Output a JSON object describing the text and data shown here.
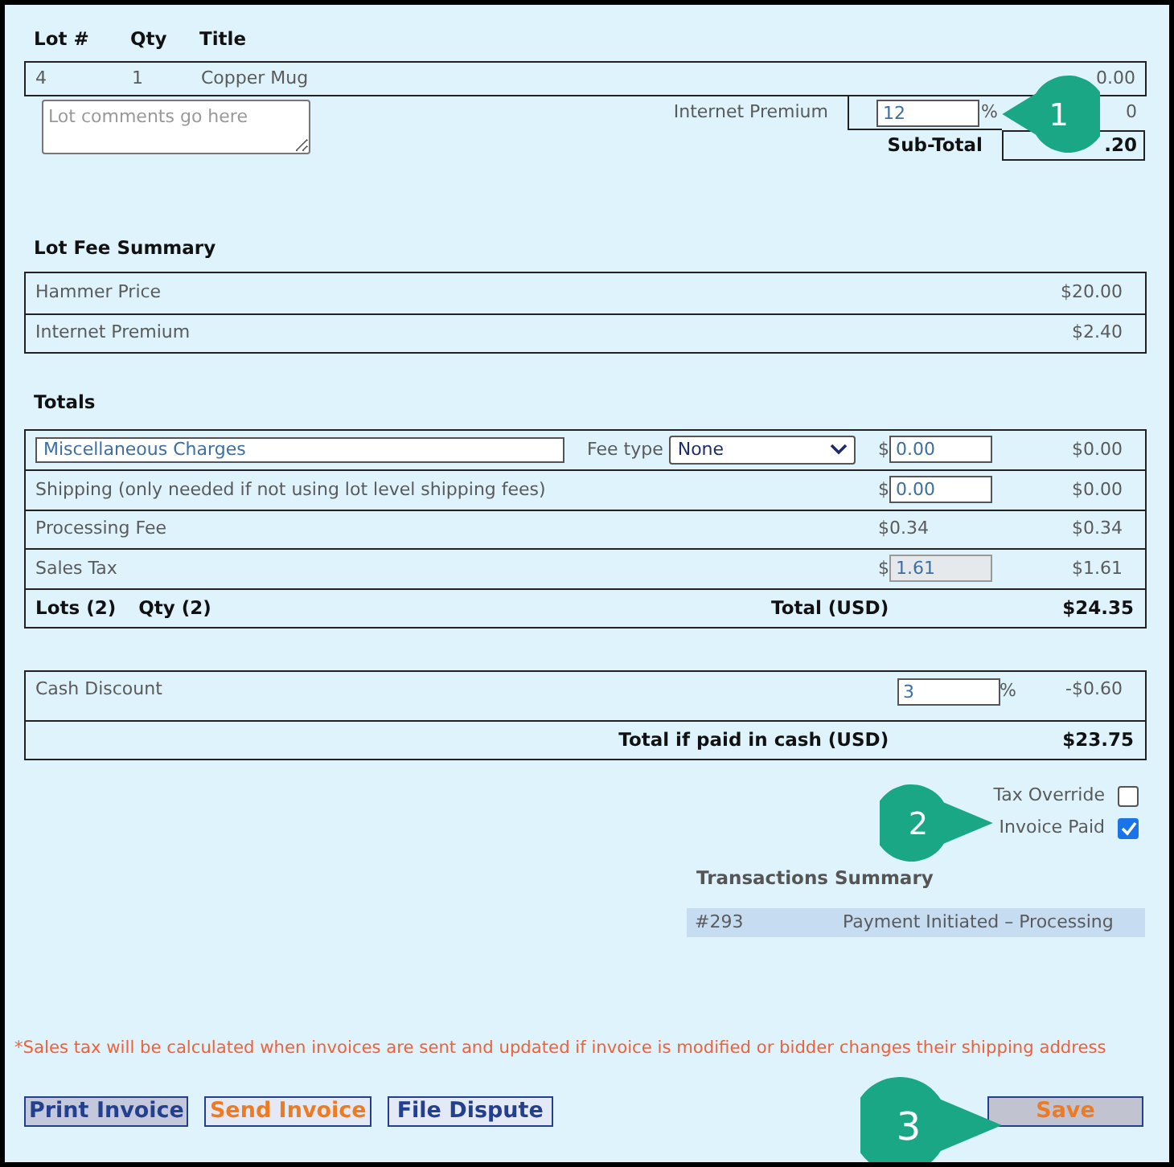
{
  "lot_table": {
    "columns": [
      "Lot #",
      "Qty",
      "Title"
    ],
    "rows": [
      {
        "lot": "4",
        "qty": "1",
        "title": "Copper Mug",
        "amount": "0.00"
      }
    ]
  },
  "lot_comments": {
    "placeholder": "Lot comments go here"
  },
  "internet_premium": {
    "label": "Internet Premium",
    "value": "12",
    "unit": "%",
    "amount": "0"
  },
  "subtotal": {
    "label": "Sub-Total",
    "amount": ".20"
  },
  "lot_fee_summary": {
    "title": "Lot Fee Summary",
    "rows": [
      {
        "label": "Hammer Price",
        "amount": "$20.00"
      },
      {
        "label": "Internet Premium",
        "amount": "$2.40"
      }
    ]
  },
  "totals": {
    "title": "Totals",
    "rows": [
      {
        "kind": "misc",
        "label": "Miscellaneous Charges",
        "fee_type_label": "Fee type",
        "fee_type": "None",
        "currency": "$",
        "value": "0.00",
        "disabled": false,
        "amount": "$0.00"
      },
      {
        "kind": "input",
        "label": "Shipping (only needed if not using lot level shipping fees)",
        "currency": "$",
        "value": "0.00",
        "disabled": false,
        "amount": "$0.00"
      },
      {
        "kind": "fixed",
        "label": "Processing Fee",
        "value": "$0.34",
        "amount": "$0.34"
      },
      {
        "kind": "input",
        "label": "Sales Tax",
        "currency": "$",
        "value": "1.61",
        "disabled": true,
        "amount": "$1.61"
      }
    ],
    "summary": {
      "lots": "Lots (2)",
      "qty": "Qty (2)",
      "label": "Total (USD)",
      "amount": "$24.35"
    }
  },
  "cash_discount": {
    "label": "Cash Discount",
    "value": "3",
    "unit": "%",
    "amount": "-$0.60",
    "total_label": "Total if paid in cash (USD)",
    "total": "$23.75"
  },
  "options": [
    {
      "label": "Tax Override",
      "checked": false
    },
    {
      "label": "Invoice Paid",
      "checked": true
    }
  ],
  "transactions": {
    "title": "Transactions Summary",
    "rows": [
      {
        "id": "#293",
        "status": "Payment Initiated – Processing"
      }
    ]
  },
  "note": "*Sales tax will be calculated when invoices are sent and updated if invoice is modified or bidder changes their shipping address",
  "buttons": [
    {
      "label": "Print Invoice",
      "kind": "print"
    },
    {
      "label": "Send Invoice",
      "kind": "send"
    },
    {
      "label": "File Dispute",
      "kind": "dispute"
    }
  ],
  "save_button": {
    "label": "Save"
  },
  "callouts": [
    "1",
    "2",
    "3"
  ]
}
